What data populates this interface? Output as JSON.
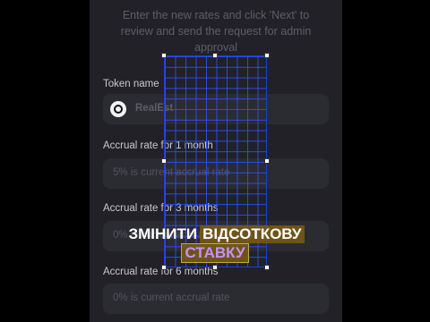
{
  "intro_text": [
    "Enter the new rates and click 'Next' to",
    "review and send the request for admin",
    "approval"
  ],
  "token": {
    "label": "Token name",
    "value": "RealEst",
    "icon": "token-logo-icon"
  },
  "rates": [
    {
      "label": "Accrual rate for 1 month",
      "placeholder": "5% is current accrual rate"
    },
    {
      "label": "Accrual rate for 3 months",
      "placeholder": "0% is current accrual rate"
    },
    {
      "label": "Accrual rate for 6 months",
      "placeholder": "0% is current accrual rate"
    }
  ],
  "overlay": {
    "caption_part1": "ЗМІНИТИ",
    "caption_part2": "ВІДСОТКОВУ",
    "caption_line2": "СТАВКУ",
    "grid_color": "#2c4eff",
    "caption_bg": "#7a5c12"
  },
  "colors": {
    "panel_bg": "#212127",
    "field_bg": "#2b2b32",
    "page_bg": "#000000"
  }
}
